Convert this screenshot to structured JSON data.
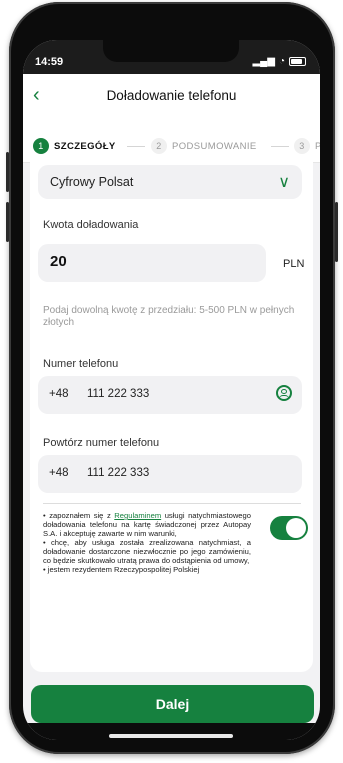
{
  "status": {
    "time": "14:59",
    "signal": "▂▄▆",
    "wifi": "◔"
  },
  "header": {
    "back_icon": "‹",
    "title": "Doładowanie telefonu"
  },
  "steps": [
    {
      "num": "1",
      "label": "SZCZEGÓŁY"
    },
    {
      "num": "2",
      "label": "PODSUMOWANIE"
    },
    {
      "num": "3",
      "label": "P"
    }
  ],
  "operator": {
    "value": "Cyfrowy Polsat",
    "chevron": "∨"
  },
  "amount": {
    "label": "Kwota doładowania",
    "value": "20",
    "unit": "PLN",
    "hint": "Podaj dowolną kwotę z przedziału: 5-500 PLN w pełnych złotych"
  },
  "phone": {
    "label": "Numer telefonu",
    "prefix": "+48",
    "value": "111 222 333"
  },
  "phone_repeat": {
    "label": "Powtórz numer telefonu",
    "prefix": "+48",
    "value": "111 222 333"
  },
  "terms": {
    "pre_link": "• zapoznałem się z ",
    "link": "Regulaminem",
    "post_link": " usługi natychmiastowego doładowania telefonu na kartę świadczonej przez Autopay S.A. i akceptuję zawarte w nim warunki,",
    "line2": "• chcę, aby usługa została zrealizowana natychmiast, a doładowanie dostarczone niezwłocznie po jego zamówieniu, co będzie skutkowało utratą prawa do odstąpienia od umowy,",
    "line3": "• jestem rezydentem Rzeczypospolitej Polskiej",
    "toggle_on": true
  },
  "cta": {
    "label": "Dalej"
  },
  "colors": {
    "accent": "#16813f",
    "field_bg": "#f1f1f3",
    "screen_bg": "#f2f2f4"
  }
}
